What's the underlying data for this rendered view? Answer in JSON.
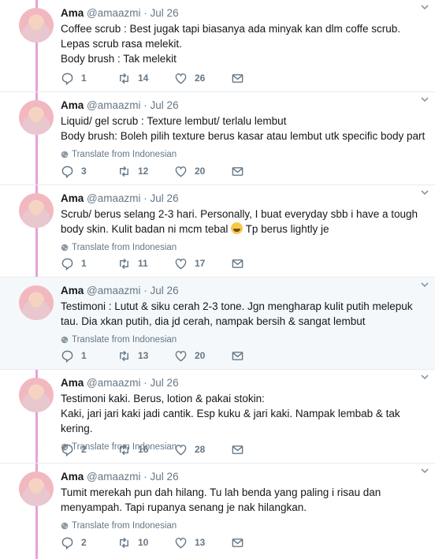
{
  "author": {
    "name": "Ama",
    "handle": "@amaazmi",
    "date": "Jul 26"
  },
  "translate_label": "Translate from Indonesian",
  "tweets": [
    {
      "lines": [
        "Coffee scrub : Best jugak tapi biasanya ada minyak kan dlm coffe scrub.",
        "Lepas scrub rasa melekit.",
        "Body brush : Tak melekit"
      ],
      "replies": "1",
      "retweets": "14",
      "likes": "26",
      "translate": false
    },
    {
      "lines": [
        "Liquid/ gel scrub : Texture lembut/ terlalu lembut",
        "Body brush: Boleh pilih texture berus kasar atau lembut utk specific body part"
      ],
      "replies": "3",
      "retweets": "12",
      "likes": "20",
      "translate": true
    },
    {
      "lines": [
        "Scrub/ berus selang 2-3 hari. Personally, I buat everyday sbb i have a tough",
        "body skin. Kulit badan ni mcm tebal",
        "Tp berus lightly je"
      ],
      "emoji": "grinning-sweat-emoji",
      "replies": "1",
      "retweets": "11",
      "likes": "17",
      "translate": true
    },
    {
      "lines": [
        "Testimoni : Lutut & siku cerah 2-3 tone. Jgn mengharap kulit putih melepuk",
        "tau. Dia xkan putih, dia jd cerah, nampak bersih & sangat lembut"
      ],
      "replies": "1",
      "retweets": "13",
      "likes": "20",
      "translate": true
    },
    {
      "lines": [
        "Testimoni kaki. Berus, lotion & pakai stokin:",
        "Kaki, jari jari kaki jadi cantik. Esp kuku & jari kaki. Nampak lembab & tak kering."
      ],
      "replies": "2",
      "retweets": "16",
      "likes": "28",
      "translate": true
    },
    {
      "lines": [
        "Tumit merekah pun dah hilang. Tu lah benda yang paling i risau dan",
        "menyampah. Tapi rupanya senang je nak hilangkan."
      ],
      "replies": "2",
      "retweets": "10",
      "likes": "13",
      "translate": true
    }
  ],
  "colors": {
    "thread_line": "#e6a2d9",
    "highlight_bg": "#f5f8fa",
    "secondary_text": "#657786"
  }
}
